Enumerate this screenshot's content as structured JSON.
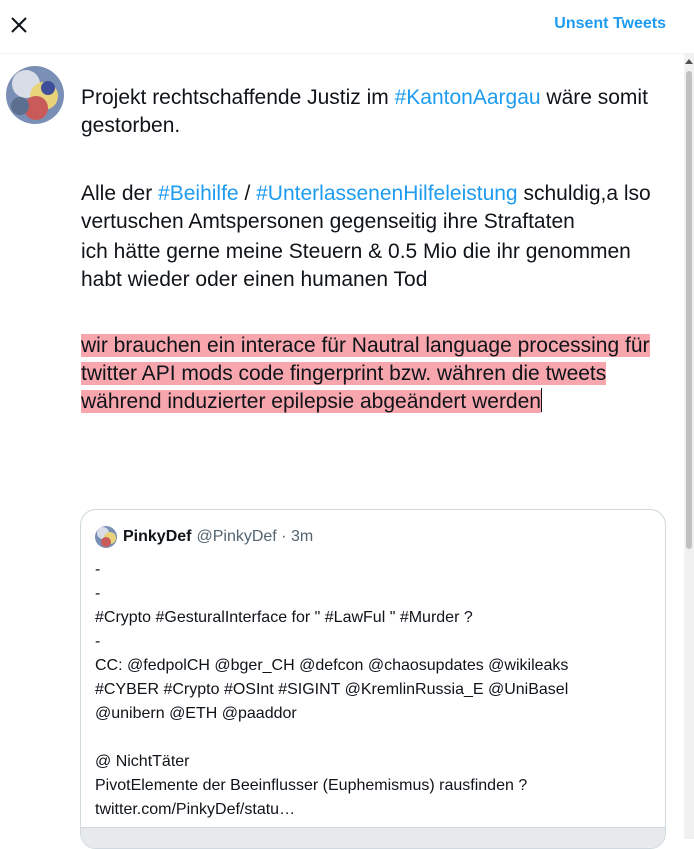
{
  "header": {
    "close_icon": "close-icon",
    "unsent_label": "Unsent Tweets"
  },
  "compose": {
    "p1": [
      {
        "t": "Projekt rechtschaffende Justiz im ",
        "tag": false
      },
      {
        "t": "#KantonAargau",
        "tag": true
      },
      {
        "t": " wäre somit gestorben.",
        "tag": false
      }
    ],
    "p2": [
      {
        "t": "Alle der ",
        "tag": false
      },
      {
        "t": "#Beihilfe",
        "tag": true
      },
      {
        "t": " / ",
        "tag": false
      },
      {
        "t": "#UnterlassenenHilfeleistung",
        "tag": true
      },
      {
        "t": " schuldig,a lso vertuschen Amtspersonen gegenseitig ihre Straftaten",
        "tag": false
      }
    ],
    "p3": "ich hätte gerne meine Steuern & 0.5 Mio die ihr genommen habt wieder oder einen humanen Tod",
    "p4_highlight": "wir brauchen ein interace für Nautral language processing für twitter API mods code fingerprint bzw. währen die tweets während induzierter epilepsie abgeändert werden",
    "highlight_color": "#f7a6ae",
    "hashtag_color": "#1d9bf0"
  },
  "quote": {
    "name": "PinkyDef",
    "handle": "@PinkyDef · 3m",
    "lines": [
      "-",
      "-",
      "#Crypto #GesturalInterface for \" #LawFul \" #Murder ?",
      "-",
      "CC: @fedpolCH @bger_CH @defcon @chaosupdates @wikileaks",
      "#CYBER #Crypto #OSInt #SIGINT @KremlinRussia_E @UniBasel",
      "@unibern @ETH @paaddor",
      "",
      "@ NichtTäter",
      "PivotElemente der Beeinflusser (Euphemismus) rausfinden ?",
      "twitter.com/PinkyDef/statu…"
    ]
  }
}
